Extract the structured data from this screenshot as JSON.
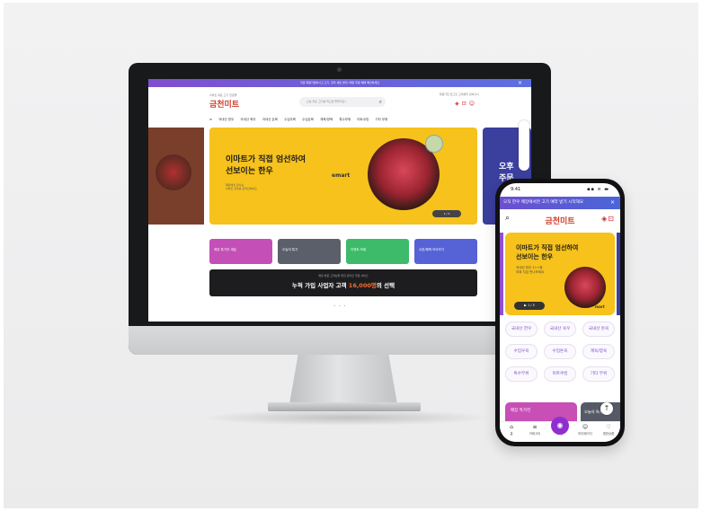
{
  "desktop": {
    "topbar_text": "지금 회원가입하시고 고기, 한우 세트 받자! 매장 주문 혜택 확인하세요",
    "logo_sub": "이마트 대표 고기 전문몰",
    "logo": "금천미트",
    "search_placeholder": "오늘 무슨 고기를 먹으면 좋을까요?",
    "util_links": "회원가입  로그인  고객센터  장바구니",
    "nav_items": [
      "국내산 한우",
      "국내산 육우",
      "국내산 돈육",
      "수입우육",
      "수입돈육",
      "계육/양육",
      "특수부위",
      "미트쿠킹",
      "기타 부위"
    ],
    "hero_title_line1": "이마트가 직접 엄선하여",
    "hero_title_line2": "선보이는 한우",
    "hero_sub_line1": "매장에서 만나는",
    "hero_sub_line2": "이마트 한우를 온라인에서도",
    "hero_brand": "emart",
    "hero_pager": "1 / 5",
    "right_banner_line1": "오후",
    "right_banner_line2": "주문",
    "cards": [
      {
        "label": "매장 특가전 세일",
        "color": "#c44fb6"
      },
      {
        "label": "오늘의 특가",
        "color": "#5b5f6a"
      },
      {
        "label": "이벤트 모음",
        "color": "#3dbb6a"
      },
      {
        "label": "쿠폰/혜택 모아보기",
        "color": "#5563d6"
      }
    ],
    "banner_small": "매장 방문 고객님을 위한 온라인 주문 서비스",
    "banner_main_prefix": "누적 가입 사업자 고객",
    "banner_main_highlight": "16,000명",
    "banner_main_suffix": "의 선택",
    "pager_dots": "• • •"
  },
  "phone": {
    "time": "9:41",
    "status_right": "▪▪ ≋ ▬",
    "topbar_text": "오직 한우 매장에서만 고기 예약 받기 시작해요",
    "logo": "금천미트",
    "hero_title_line1": "이마트가 직접 엄선하여",
    "hero_title_line2": "선보이는 한우",
    "hero_sub_line1": "국내산 한우 1++등",
    "hero_sub_line2": "부위 지금 만나보세요",
    "hero_pager": "▶  1 / 5",
    "hero_brand": "mart",
    "chips": [
      "국내산 한우",
      "국내산 육우",
      "국내산 돈육",
      "수입우육",
      "수입돈육",
      "계육/양육",
      "특수부위",
      "미트쿠킹",
      "기타 부위"
    ],
    "card1": "매장 특가전",
    "card2": "오늘의 특가",
    "tabs": [
      {
        "icon": "⌂",
        "label": "홈"
      },
      {
        "icon": "≡",
        "label": "카테고리"
      },
      {
        "icon": "",
        "label": "쇼핑"
      },
      {
        "icon": "☺",
        "label": "마이페이지"
      },
      {
        "icon": "♡",
        "label": "찜한상품"
      }
    ]
  },
  "colors": {
    "accent_yellow": "#f6c21b",
    "brand_red": "#d03a2b",
    "brand_purple": "#8f2fd0"
  }
}
